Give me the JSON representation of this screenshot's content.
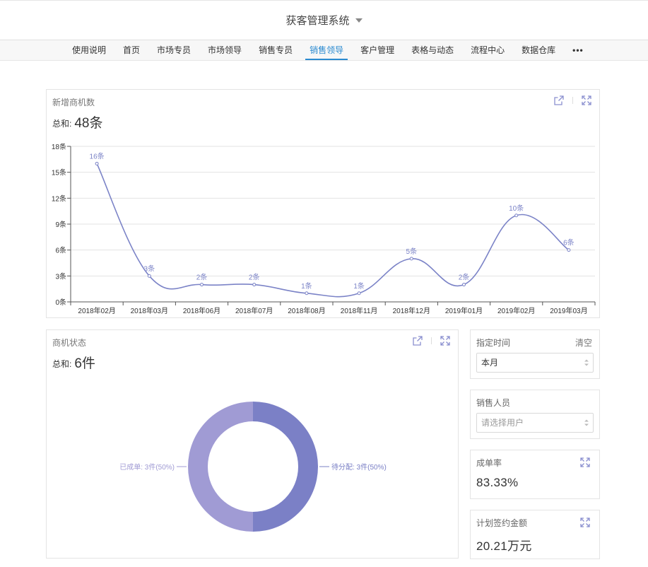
{
  "header": {
    "title": "获客管理系统"
  },
  "nav": {
    "items": [
      "使用说明",
      "首页",
      "市场专员",
      "市场领导",
      "销售专员",
      "销售领导",
      "客户管理",
      "表格与动态",
      "流程中心",
      "数据仓库"
    ],
    "active": "销售领导",
    "more": "•••"
  },
  "new_opps": {
    "title": "新增商机数",
    "total_label": "总和:",
    "total_value": "48条"
  },
  "opp_status": {
    "title": "商机状态",
    "total_label": "总和:",
    "total_value": "6件"
  },
  "filters": {
    "time_label": "指定时间",
    "clear_label": "清空",
    "time_value": "本月",
    "sales_label": "销售人员",
    "sales_placeholder": "请选择用户"
  },
  "kpis": {
    "close_rate_label": "成单率",
    "close_rate_value": "83.33%",
    "contract_label": "计划签约金额",
    "contract_value": "20.21万元"
  },
  "colors": {
    "accent": "#2a8ad0",
    "line": "#7b83c7",
    "donut_a": "#7b80c6",
    "donut_b": "#a09bd4"
  },
  "chart_data": [
    {
      "type": "line",
      "categories": [
        "2018年02月",
        "2018年03月",
        "2018年06月",
        "2018年07月",
        "2018年08月",
        "2018年11月",
        "2018年12月",
        "2019年01月",
        "2019年02月",
        "2019年03月"
      ],
      "values": [
        16,
        3,
        2,
        2,
        1,
        1,
        5,
        2,
        10,
        6
      ],
      "data_labels": [
        "16条",
        "3条",
        "2条",
        "2条",
        "1条",
        "1条",
        "5条",
        "2条",
        "10条",
        "6条"
      ],
      "y_ticks": [
        "0条",
        "3条",
        "6条",
        "9条",
        "12条",
        "15条",
        "18条"
      ],
      "ylim": [
        0,
        18
      ],
      "grid": true
    },
    {
      "type": "pie",
      "labels": [
        "待分配",
        "已成单"
      ],
      "values": [
        3,
        3
      ],
      "slice_labels": [
        "待分配: 3件(50%)",
        "已成单: 3件(50%)"
      ]
    }
  ]
}
